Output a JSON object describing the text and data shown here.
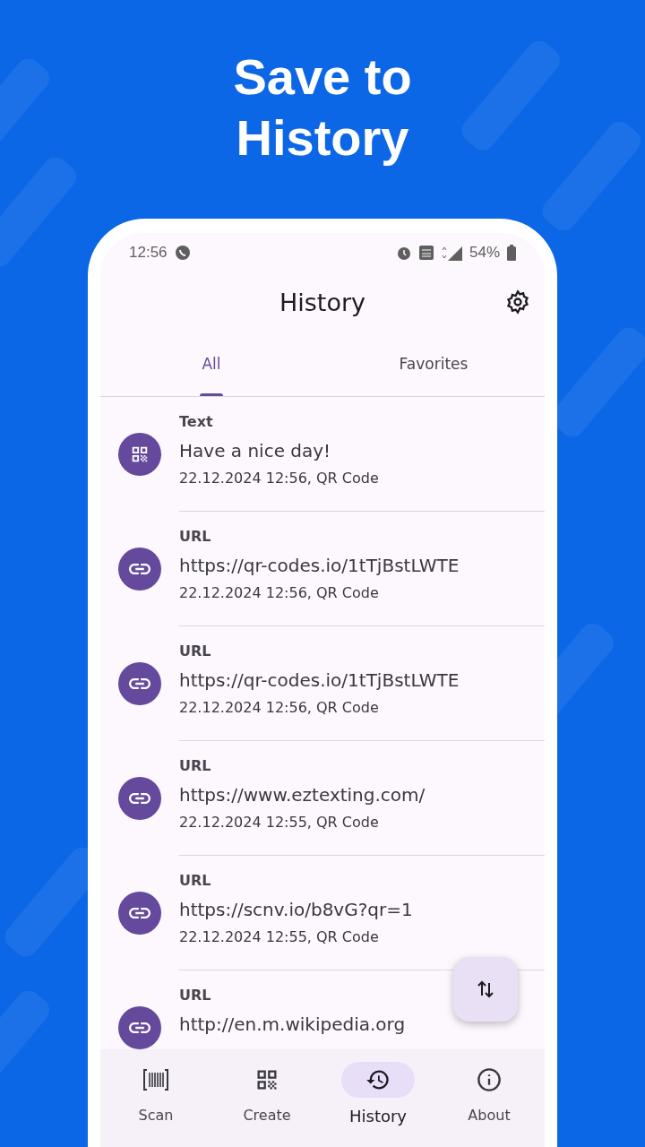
{
  "headline": "Save to History",
  "status_bar": {
    "time": "12:56",
    "battery": "54%"
  },
  "app_bar": {
    "title": "History"
  },
  "tabs": [
    {
      "label": "All",
      "selected": true
    },
    {
      "label": "Favorites",
      "selected": false
    }
  ],
  "items": [
    {
      "kind": "text",
      "type": "Text",
      "content": "Have a nice day!",
      "meta": "22.12.2024 12:56, QR Code"
    },
    {
      "kind": "url",
      "type": "URL",
      "content": "https://qr-codes.io/1tTjBstLWTE",
      "meta": "22.12.2024 12:56, QR Code"
    },
    {
      "kind": "url",
      "type": "URL",
      "content": "https://qr-codes.io/1tTjBstLWTE",
      "meta": "22.12.2024 12:56, QR Code"
    },
    {
      "kind": "url",
      "type": "URL",
      "content": "https://www.eztexting.com/",
      "meta": "22.12.2024 12:55, QR Code"
    },
    {
      "kind": "url",
      "type": "URL",
      "content": "https://scnv.io/b8vG?qr=1",
      "meta": "22.12.2024 12:55, QR Code"
    },
    {
      "kind": "url",
      "type": "URL",
      "content": "http://en.m.wikipedia.org"
    }
  ],
  "nav": [
    {
      "kind": "scan",
      "label": "Scan",
      "selected": false
    },
    {
      "kind": "create",
      "label": "Create",
      "selected": false
    },
    {
      "kind": "history",
      "label": "History",
      "selected": true
    },
    {
      "kind": "about",
      "label": "About",
      "selected": false
    }
  ]
}
